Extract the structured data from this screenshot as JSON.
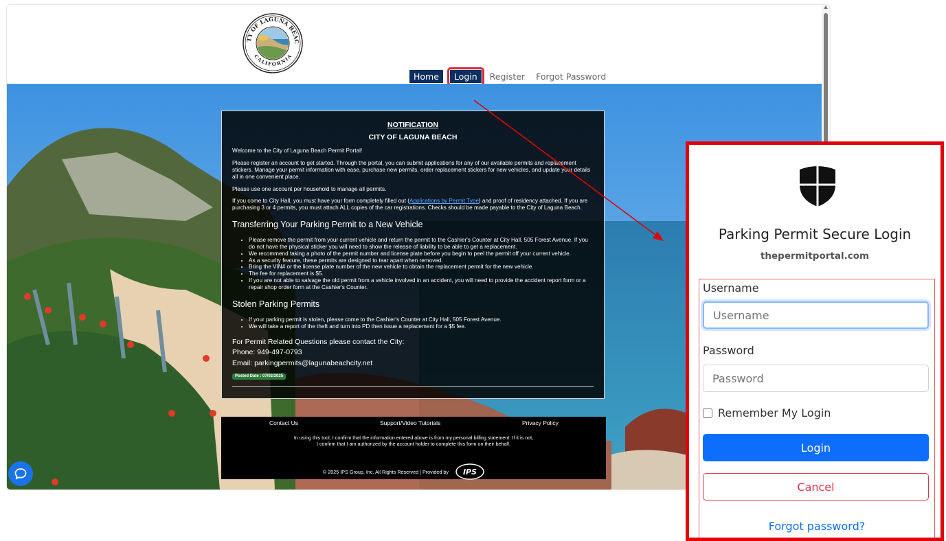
{
  "seal": {
    "top_text": "CITY OF LAGUNA BEACH",
    "bottom_text": "CALIFORNIA"
  },
  "nav": {
    "home": "Home",
    "login": "Login",
    "register": "Register",
    "forgot_password": "Forgot Password"
  },
  "notice": {
    "heading": "NOTIFICATION",
    "subheading": "CITY OF LAGUNA BEACH",
    "welcome": "Welcome to the City of Laguna Beach Permit Portal!",
    "intro": "Please register an account to get started. Through the portal, you can submit applications for any of our available permits and replacement stickers. Manage your permit information with ease, purchase new permits, order replacement stickers for new vehicles, and update your details all in one convenient place.",
    "household": "Please use one account per household to manage all permits.",
    "city_hall_before": "If you come to City Hall, you must have your form completely filled out (",
    "city_hall_link": "Applications by Permit Type",
    "city_hall_after": ") and proof of residency attached.  If you are purchasing 3 or 4 permits, you must attach ALL copies of the car registrations. Checks should be made payable to the City of Laguna Beach.",
    "transfer_title": "Transferring Your Parking Permit to a New Vehicle",
    "transfer_items": [
      "Please remove the permit from your current vehicle and return the permit to the Cashier's Counter at City Hall, 505 Forest Avenue. If you do not have the physical sticker you will need to show the release of liability to be able to get a replacement.",
      "We recommend taking a photo of the permit number and license plate before you begin to peel the permit off your current vehicle.",
      "As a security feature, these permits are designed to tear apart when removed.",
      "Bring the VIN# or the license plate number of the new vehicle to obtain the replacement permit for the new vehicle.",
      "The fee for replacement is $5.",
      "If you are not able to salvage the old permit from a vehicle involved in an accident, you will need to provide the accident report form or a repair shop order form at the Cashier's Counter."
    ],
    "stolen_title": "Stolen Parking Permits",
    "stolen_items": [
      "If your parking permit is stolen, please come to the Cashier's Counter at City Hall, 505 Forest Avenue.",
      "We will take a report of the theft and turn into PD then issue a replacement for a $5 fee."
    ],
    "contact_heading": "For Permit Related Questions please contact the City:",
    "phone": "Phone: 949-497-0793",
    "email": "Email: parkingpermits@lagunabeachcity.net",
    "posted_date": "Posted Date : 07/02/2025"
  },
  "footer": {
    "contact_us": "Contact Us",
    "support": "Support/Video Tutorials",
    "privacy": "Privacy Policy",
    "disclaimer": "In using this tool, I confirm that the information entered above is from my personal billing statement. If it is not, I confirm that I am authorized by the account holder to complete this form on their behalf.",
    "copyright": "© 2025 IPS Group, Inc. All Rights Reserved  | Provided by",
    "ips_logo_text": "IPS"
  },
  "login_panel": {
    "title": "Parking Permit Secure Login",
    "domain": "thepermitportal.com",
    "username_label": "Username",
    "username_placeholder": "Username",
    "password_label": "Password",
    "password_placeholder": "Password",
    "remember_label": "Remember My Login",
    "login_button": "Login",
    "cancel_button": "Cancel",
    "forgot_link": "Forgot password?"
  },
  "colors": {
    "nav_bg": "#0d2e5e",
    "highlight_red": "#e0000c",
    "primary_blue": "#0d6efd",
    "cancel_red": "#dc3545"
  },
  "icons": [
    "city-seal-logo",
    "shield-icon",
    "chat-icon",
    "ips-logo",
    "scroll-up-icon"
  ]
}
